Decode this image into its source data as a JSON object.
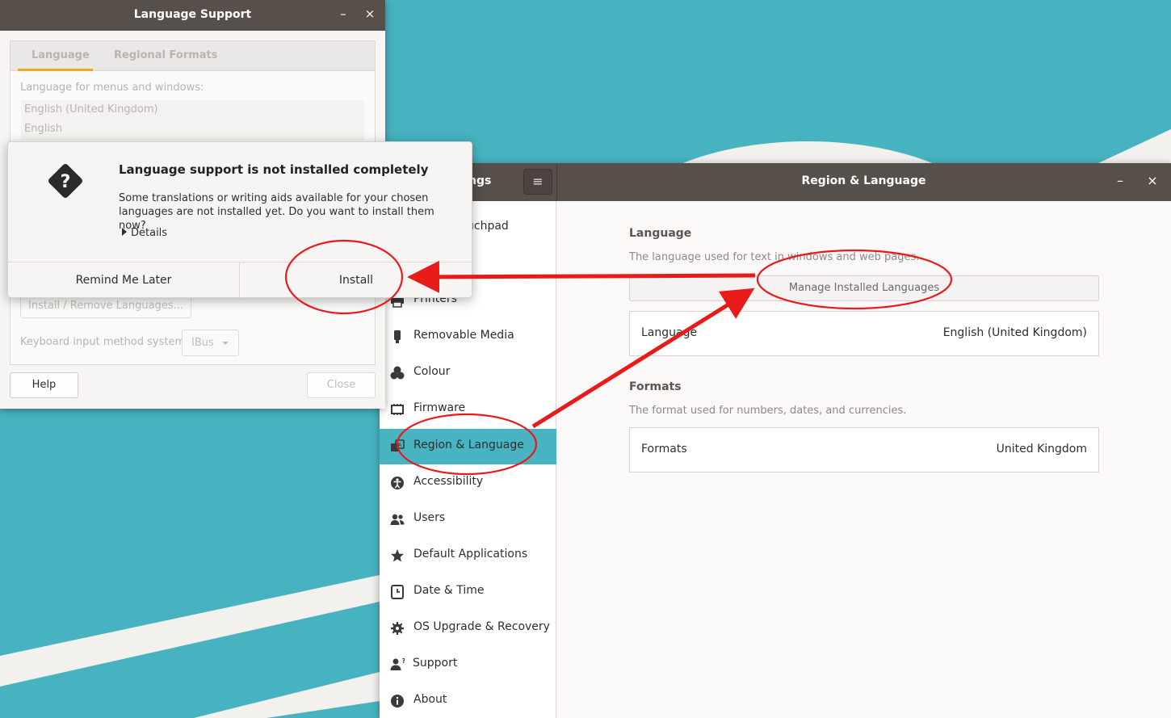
{
  "settings": {
    "sidebar_title_fragment": "ngs",
    "menu_glyph": "≡",
    "window_title": "Region & Language",
    "minimize_glyph": "–",
    "close_glyph": "×",
    "sidebar_items": [
      {
        "label": "uchpad",
        "icon": "touchpad-icon"
      },
      {
        "label": "Printers",
        "icon": "printer-icon"
      },
      {
        "label": "Removable Media",
        "icon": "usb-drive-icon"
      },
      {
        "label": "Colour",
        "icon": "color-circles-icon"
      },
      {
        "label": "Firmware",
        "icon": "chip-icon"
      },
      {
        "label": "Region & Language",
        "icon": "language-icon",
        "active": true
      },
      {
        "label": "Accessibility",
        "icon": "accessibility-icon"
      },
      {
        "label": "Users",
        "icon": "users-icon"
      },
      {
        "label": "Default Applications",
        "icon": "star-icon"
      },
      {
        "label": "Date & Time",
        "icon": "clock-icon"
      },
      {
        "label": "OS Upgrade & Recovery",
        "icon": "gear-icon"
      },
      {
        "label": "Support",
        "icon": "support-person-icon"
      },
      {
        "label": "About",
        "icon": "info-icon"
      }
    ],
    "language_heading": "Language",
    "language_desc": "The language used for text in windows and web pages.",
    "manage_button": "Manage Installed Languages",
    "language_row_label": "Language",
    "language_row_value": "English (United Kingdom)",
    "formats_heading": "Formats",
    "formats_desc": "The format used for numbers, dates, and currencies.",
    "formats_row_label": "Formats",
    "formats_row_value": "United Kingdom",
    "accent_color": "#48b3c1",
    "header_color": "#574f4a"
  },
  "language_support": {
    "window_title": "Language Support",
    "minimize_glyph": "–",
    "close_glyph": "×",
    "tabs": [
      "Language",
      "Regional Formats"
    ],
    "menus_label": "Language for menus and windows:",
    "languages": [
      "English (United Kingdom)",
      "English"
    ],
    "install_remove_button": "Install / Remove Languages...",
    "keyboard_label": "Keyboard input method system:",
    "keyboard_value": "IBus",
    "help_button": "Help",
    "close_button": "Close",
    "tab_accent": "#f5a623"
  },
  "dialog": {
    "title": "Language support is not installed completely",
    "body": "Some translations or writing aids available for your chosen languages are not installed yet. Do you want to install them now?",
    "details_label": "Details",
    "remind_button": "Remind Me Later",
    "install_button": "Install",
    "icon": "question-diamond-icon"
  },
  "annotation_color": "#e81b1b"
}
